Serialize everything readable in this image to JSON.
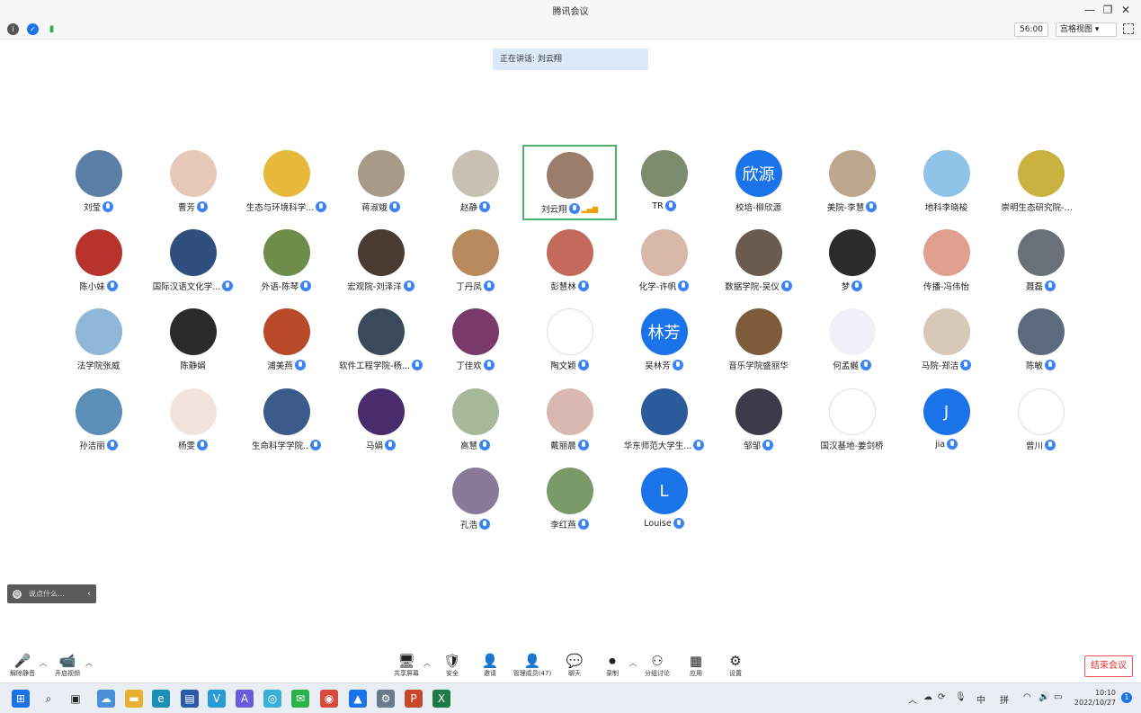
{
  "window": {
    "title": "腾讯会议",
    "controls": [
      "—",
      "❐",
      "✕"
    ]
  },
  "toolbar": {
    "timer": "56:00",
    "view_label": "宫格视图 ▾"
  },
  "speaking_banner": "正在讲话: 刘云翔",
  "participants": [
    {
      "name": "刘莹",
      "avatar_color": "#5b7fa6",
      "mic": true
    },
    {
      "name": "曹芳",
      "avatar_color": "#e8c8b8",
      "mic": true
    },
    {
      "name": "生态与环境科学...",
      "avatar_color": "#e6b93a",
      "mic": true
    },
    {
      "name": "蒋淑娥",
      "avatar_color": "#a89a88",
      "mic": true
    },
    {
      "name": "赵静",
      "avatar_color": "#c9c2b4",
      "mic": true
    },
    {
      "name": "刘云翔",
      "avatar_color": "#9b7d6b",
      "mic": true,
      "active": true
    },
    {
      "name": "TR",
      "avatar_color": "#7d8c6e",
      "mic": true
    },
    {
      "name": "校培-柳欣源",
      "avatar_color": "#1a73e8",
      "mic": false,
      "avatar_text": "欣源"
    },
    {
      "name": "美院-李慧",
      "avatar_color": "#bda78f",
      "mic": true
    },
    {
      "name": "地科李晓梭",
      "avatar_color": "#8fc4e8",
      "mic": false
    },
    {
      "name": "崇明生态研究院-李...",
      "avatar_color": "#c9b23f",
      "mic": false
    },
    {
      "name": "陈小妹",
      "avatar_color": "#b8332b",
      "mic": true
    },
    {
      "name": "国际汉语文化学...",
      "avatar_color": "#2f4f7f",
      "mic": true
    },
    {
      "name": "外语-陈琴",
      "avatar_color": "#6f8d4a",
      "mic": true
    },
    {
      "name": "宏观院-刘泽洋",
      "avatar_color": "#4a3b32",
      "mic": true
    },
    {
      "name": "丁丹凤",
      "avatar_color": "#b98a5d",
      "mic": true
    },
    {
      "name": "彭慧林",
      "avatar_color": "#c46a5b",
      "mic": true
    },
    {
      "name": "化学-许帆",
      "avatar_color": "#d8b8a8",
      "mic": true
    },
    {
      "name": "数据学院-吴仪",
      "avatar_color": "#6b5b4e",
      "mic": true
    },
    {
      "name": "梦",
      "avatar_color": "#2b2b2b",
      "mic": true
    },
    {
      "name": "传播-冯伟怡",
      "avatar_color": "#e0a090",
      "mic": false
    },
    {
      "name": "聂磊",
      "avatar_color": "#6a7078",
      "mic": true
    },
    {
      "name": "法学院张威",
      "avatar_color": "#8fb8d8",
      "mic": false
    },
    {
      "name": "陈静娟",
      "avatar_color": "#2a2a2a",
      "mic": false
    },
    {
      "name": "浦美燕",
      "avatar_color": "#b84a2a",
      "mic": true
    },
    {
      "name": "软件工程学院-杨...",
      "avatar_color": "#3b4a5b",
      "mic": true
    },
    {
      "name": "丁佳欢",
      "avatar_color": "#7a3b6b",
      "mic": true
    },
    {
      "name": "陶文颖",
      "avatar_color": "#ffffff",
      "mic": true
    },
    {
      "name": "吴林芳",
      "avatar_color": "#1a73e8",
      "mic": true,
      "avatar_text": "林芳"
    },
    {
      "name": "音乐学院盛丽华",
      "avatar_color": "#7d5b3b",
      "mic": false
    },
    {
      "name": "何孟樾",
      "avatar_color": "#eef2f8",
      "mic": true
    },
    {
      "name": "马院-郑洁",
      "avatar_color": "#d8c8b8",
      "mic": true
    },
    {
      "name": "陈敏",
      "avatar_color": "#5b6b7d",
      "mic": true
    },
    {
      "name": "孙洁丽",
      "avatar_color": "#5b8fb8",
      "mic": true
    },
    {
      "name": "杨雯",
      "avatar_color": "#f2e4dc",
      "mic": true
    },
    {
      "name": "生命科学学院..",
      "avatar_color": "#3b5b8a",
      "mic": true
    },
    {
      "name": "马娟",
      "avatar_color": "#4a2b6b",
      "mic": true
    },
    {
      "name": "高慧",
      "avatar_color": "#a8b89a",
      "mic": true
    },
    {
      "name": "戴丽晨",
      "avatar_color": "#d8b8b0",
      "mic": true
    },
    {
      "name": "华东师范大学生...",
      "avatar_color": "#2b5b9a",
      "mic": true
    },
    {
      "name": "邹邹",
      "avatar_color": "#3b3b4a",
      "mic": true
    },
    {
      "name": "国汉基地-姜剑桥",
      "avatar_color": "#ffffff",
      "mic": false
    },
    {
      "name": "jia",
      "avatar_color": "#1a73e8",
      "mic": true,
      "avatar_text": "J"
    },
    {
      "name": "曾川",
      "avatar_color": "#ffffff",
      "mic": true
    },
    {
      "name": "孔浩",
      "avatar_color": "#8a7a9a",
      "mic": true
    },
    {
      "name": "李红燕",
      "avatar_color": "#7a9a6a",
      "mic": true
    },
    {
      "name": "Louise",
      "avatar_color": "#1a73e8",
      "mic": true,
      "avatar_text": "L"
    }
  ],
  "chat": {
    "placeholder": "说点什么..."
  },
  "controls": [
    {
      "icon": "mic-off-icon",
      "glyph": "🎤",
      "label": "解除静音"
    },
    {
      "icon": "video-off-icon",
      "glyph": "📹",
      "label": "开启视频"
    },
    {
      "icon": "share-screen-icon",
      "glyph": "🖥",
      "label": "共享屏幕"
    },
    {
      "icon": "security-icon",
      "glyph": "🛡",
      "label": "安全"
    },
    {
      "icon": "invite-icon",
      "glyph": "👤",
      "label": "邀请"
    },
    {
      "icon": "members-icon",
      "glyph": "👤",
      "label": "管理成员(47)"
    },
    {
      "icon": "chat-icon",
      "glyph": "💬",
      "label": "聊天"
    },
    {
      "icon": "record-icon",
      "glyph": "⏺",
      "label": "录制"
    },
    {
      "icon": "breakout-icon",
      "glyph": "⚇",
      "label": "分组讨论"
    },
    {
      "icon": "apps-icon",
      "glyph": "▦",
      "label": "应用"
    },
    {
      "icon": "settings-icon",
      "glyph": "⚙",
      "label": "设置"
    }
  ],
  "end_button": "结束会议",
  "taskbar": {
    "apps": [
      {
        "icon": "start-icon",
        "color": "#1a73e8",
        "glyph": "⊞"
      },
      {
        "icon": "search-icon",
        "color": "#e9eef4",
        "glyph": "⌕"
      },
      {
        "icon": "taskview-icon",
        "color": "#e9eef4",
        "glyph": "▣"
      },
      {
        "icon": "onedrive-icon",
        "color": "#4a90d9",
        "glyph": "☁"
      },
      {
        "icon": "folder-icon",
        "color": "#e8b030",
        "glyph": "▬"
      },
      {
        "icon": "edge-icon",
        "color": "#1a8fb8",
        "glyph": "e"
      },
      {
        "icon": "store-icon",
        "color": "#2b5ba8",
        "glyph": "▤"
      },
      {
        "icon": "vscode-like-icon",
        "color": "#2b9bd8",
        "glyph": "V"
      },
      {
        "icon": "app-icon",
        "color": "#6a5bd8",
        "glyph": "A"
      },
      {
        "icon": "app2-icon",
        "color": "#3bb0d8",
        "glyph": "◎"
      },
      {
        "icon": "wechat-icon",
        "color": "#2bb04a",
        "glyph": "✉"
      },
      {
        "icon": "chrome-icon",
        "color": "#d84a3b",
        "glyph": "◉"
      },
      {
        "icon": "tencent-meeting-icon",
        "color": "#1a73e8",
        "glyph": "▲"
      },
      {
        "icon": "settings-app-icon",
        "color": "#6a7a8a",
        "glyph": "⚙"
      },
      {
        "icon": "powerpoint-icon",
        "color": "#c8482b",
        "glyph": "P"
      },
      {
        "icon": "excel-icon",
        "color": "#1f7a45",
        "glyph": "X"
      }
    ],
    "tray_ime_1": "中",
    "tray_ime_2": "拼",
    "time": "10:10",
    "date": "2022/10/27",
    "notification_count": "1"
  }
}
